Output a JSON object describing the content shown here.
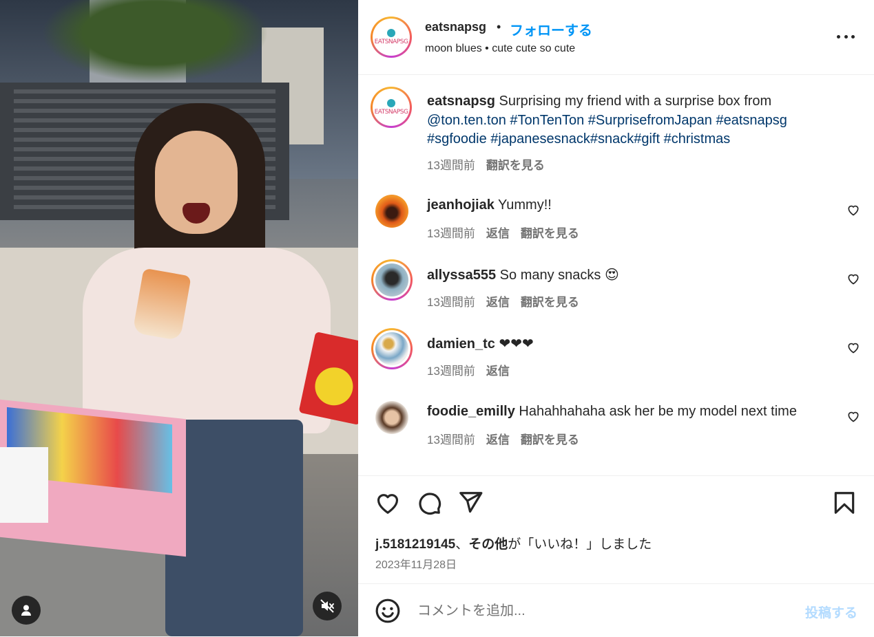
{
  "post": {
    "author": "eatsnapsg",
    "separator": "•",
    "follow_label": "フォローする",
    "subline": "moon blues • cute cute so cute",
    "logo_text": "EATSNAPSG"
  },
  "caption": {
    "author": "eatsnapsg",
    "text_plain": "Surprising my friend with a surprise box from",
    "tags_line1": "@ton.ten.ton #TonTenTon #SurprisefromJapan #eatsnapsg",
    "tags_line2": "#sgfoodie #japanesesnack#snack#gift #christmas",
    "time": "13週間前",
    "translate": "翻訳を見る"
  },
  "comments": [
    {
      "user": "jeanhojiak",
      "text": "Yummy!!",
      "time": "13週間前",
      "reply": "返信",
      "translate": "翻訳を見る"
    },
    {
      "user": "allyssa555",
      "text": "So many snacks 😍",
      "time": "13週間前",
      "reply": "返信",
      "translate": "翻訳を見る"
    },
    {
      "user": "damien_tc",
      "text": "❤❤❤",
      "time": "13週間前",
      "reply": "返信",
      "translate": ""
    },
    {
      "user": "foodie_emilly",
      "text": "Hahahhahaha ask her be my model next time",
      "time": "13週間前",
      "reply": "返信",
      "translate": "翻訳を見る"
    }
  ],
  "likes": {
    "user": "j.5181219145",
    "mid": "、",
    "others": "その他",
    "suffix": "が「いいね！」しました"
  },
  "date": "2023年11月28日",
  "composer": {
    "placeholder": "コメントを追加...",
    "post_label": "投稿する"
  },
  "icons": {
    "more": "more-options-icon",
    "like": "heart-icon",
    "comment": "comment-icon",
    "share": "share-icon",
    "save": "bookmark-icon",
    "emoji": "emoji-icon",
    "user_tag": "user-tag-icon",
    "mute": "mute-icon"
  },
  "colors": {
    "link": "#0095f6",
    "hashtag": "#00376b",
    "muted": "#737373",
    "post_disabled": "#b3dbff"
  }
}
